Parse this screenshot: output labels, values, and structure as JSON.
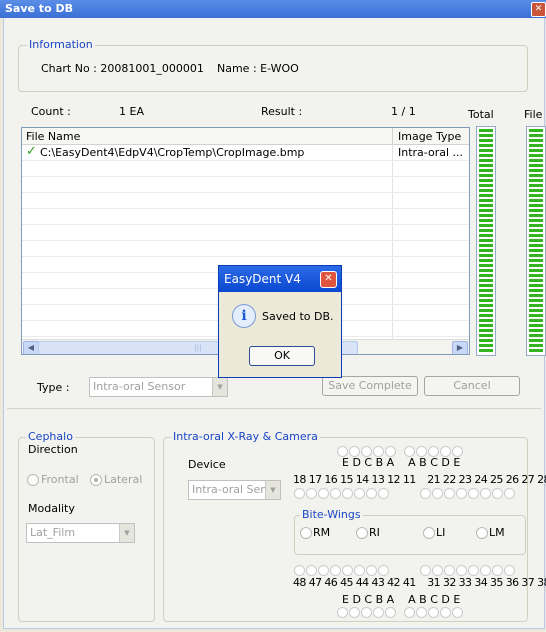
{
  "window": {
    "title": "Save to DB"
  },
  "information": {
    "legend": "Information",
    "chart_no_label": "Chart No : 20081001_000001",
    "name_label": "Name : E-WOO"
  },
  "summary": {
    "count_label": "Count :",
    "count_value": "1 EA",
    "result_label": "Result :",
    "result_value": "1 / 1",
    "total_label": "Total",
    "file_label": "File"
  },
  "file_list": {
    "columns": [
      "File Name",
      "Image Type"
    ],
    "rows": [
      {
        "file": "C:\\EasyDent4\\EdpV4\\CropTemp\\CropImage.bmp",
        "type": "Intra-oral ...",
        "status": "check-icon"
      }
    ],
    "scroll_thumb": "|||"
  },
  "type_row": {
    "label": "Type :",
    "value": "Intra-oral Sensor",
    "save_complete": "Save Complete",
    "cancel": "Cancel"
  },
  "cephalo": {
    "legend": "Cephalo",
    "direction_label": "Direction",
    "frontal": "Frontal",
    "lateral": "Lateral",
    "modality_label": "Modality",
    "modality_value": "Lat_Film"
  },
  "intraoral": {
    "legend": "Intra-oral X-Ray & Camera",
    "device_label": "Device",
    "device_value": "Intra-oral Sens",
    "upper_primary": "E D C B A    A B C D E",
    "upper_teeth": "18 17 16 15 14 13 12 11    21 22 23 24 25 26 27 28",
    "bitewings": {
      "legend": "Bite-Wings",
      "rm": "RM",
      "ri": "RI",
      "li": "LI",
      "lm": "LM"
    },
    "lower_teeth": "48 47 46 45 44 43 42 41    31 32 33 34 35 36 37 38",
    "lower_primary": "E D C B A    A B C D E"
  },
  "dialog": {
    "title": "EasyDent V4",
    "message": "Saved to DB.",
    "ok": "OK",
    "icon": "info-icon"
  },
  "colors": {
    "accent": "#1a45c8",
    "meter_green": "#33b51f",
    "title_blue": "#0a48d1"
  }
}
